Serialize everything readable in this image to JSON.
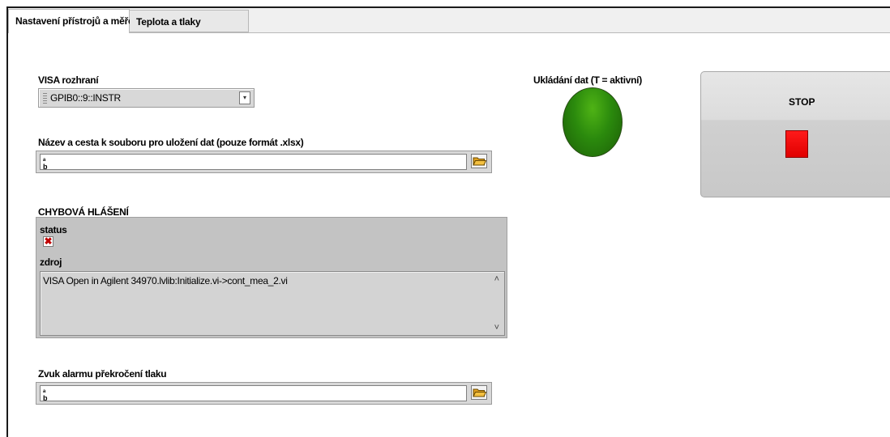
{
  "tabs": [
    {
      "label": "Nastavení přístrojů a měření"
    },
    {
      "label": "Teplota a tlaky"
    }
  ],
  "visa": {
    "label": "VISA rozhraní",
    "value": "GPIB0::9::INSTR",
    "dropdown_icon": "chevron-down-icon"
  },
  "file_path": {
    "label": "Název a cesta k souboru pro uložení dat (pouze formát .xlsx)",
    "value": "",
    "browse_icon": "folder-icon"
  },
  "error": {
    "title": "CHYBOVÁ HLÁŠENÍ",
    "status_label": "status",
    "status_icon": "x-mark-icon",
    "source_label": "zdroj",
    "source_text": "VISA Open in Agilent 34970.lvlib:Initialize.vi->cont_mea_2.vi"
  },
  "alarm_path": {
    "label": "Zvuk alarmu překročení tlaku",
    "value": "",
    "browse_icon": "folder-icon"
  },
  "save_indicator": {
    "label": "Ukládání dat (T = aktivní)",
    "color": "#2b8a0d"
  },
  "stop": {
    "label": "STOP",
    "indicator_color": "#ff0000"
  }
}
